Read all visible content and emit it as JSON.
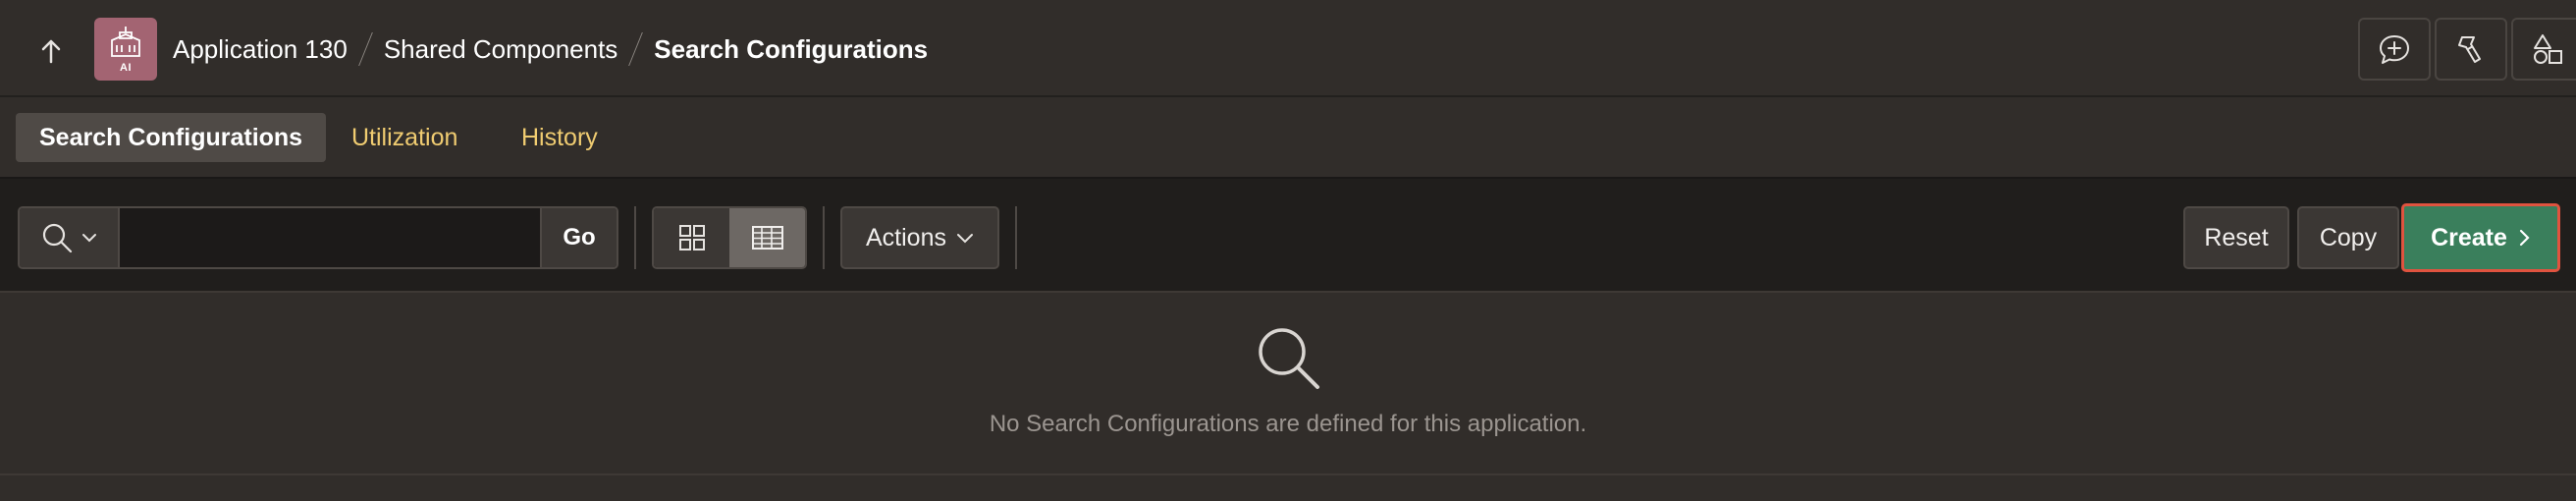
{
  "header": {
    "app_icon_text": "AI",
    "breadcrumb": [
      "Application 130",
      "Shared Components",
      "Search Configurations"
    ]
  },
  "tabs": [
    {
      "label": "Search Configurations",
      "active": true
    },
    {
      "label": "Utilization",
      "active": false
    },
    {
      "label": "History",
      "active": false
    }
  ],
  "toolbar": {
    "search_value": "",
    "go_label": "Go",
    "actions_label": "Actions",
    "reset_label": "Reset",
    "copy_label": "Copy",
    "create_label": "Create",
    "selected_view": "report"
  },
  "empty_state": {
    "message": "No Search Configurations are defined for this application."
  },
  "colors": {
    "background": "#312d2a",
    "toolbar_bg": "#201e1c",
    "tab_link": "#f0cc71",
    "create_green": "#3a7f5c",
    "create_outline": "#e0533f",
    "app_icon": "#a36472"
  },
  "icons": [
    "up-arrow-icon",
    "app-building-icon",
    "feedback-add-icon",
    "flashlight-icon",
    "shapes-icon",
    "search-icon",
    "chevron-down-icon",
    "grid-view-icon",
    "report-view-icon",
    "chevron-right-icon"
  ]
}
